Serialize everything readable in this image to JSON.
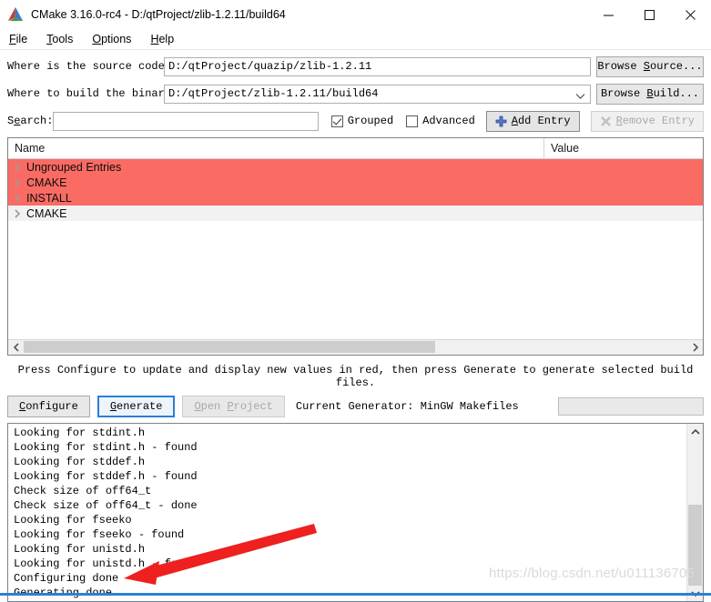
{
  "window": {
    "title": "CMake 3.16.0-rc4 - D:/qtProject/zlib-1.2.11/build64",
    "icon": "cmake-logo-icon",
    "controls": {
      "minimize": "minimize-icon",
      "maximize": "maximize-icon",
      "close": "close-icon"
    }
  },
  "menu": {
    "items": [
      {
        "label": "File",
        "mnemonic": "F"
      },
      {
        "label": "Tools",
        "mnemonic": "T"
      },
      {
        "label": "Options",
        "mnemonic": "O"
      },
      {
        "label": "Help",
        "mnemonic": "H"
      }
    ]
  },
  "form": {
    "source_label": "Where is the source code:",
    "source_value": "D:/qtProject/quazip/zlib-1.2.11",
    "browse_source_label": "Browse Source...",
    "build_label": "Where to build the binaries:",
    "build_value": "D:/qtProject/zlib-1.2.11/build64",
    "browse_build_label": "Browse Build...",
    "search_label": "Search:",
    "search_value": "",
    "search_placeholder": "",
    "grouped_label": "Grouped",
    "grouped_checked": true,
    "advanced_label": "Advanced",
    "advanced_checked": false,
    "add_entry_label": "Add Entry",
    "remove_entry_label": "Remove Entry",
    "remove_entry_enabled": false
  },
  "cache_table": {
    "columns": [
      "Name",
      "Value"
    ],
    "rows": [
      {
        "name": "Ungrouped Entries",
        "value": "",
        "state": "modified"
      },
      {
        "name": "CMAKE",
        "value": "",
        "state": "modified"
      },
      {
        "name": "INSTALL",
        "value": "",
        "state": "modified"
      },
      {
        "name": "CMAKE",
        "value": "",
        "state": "normal"
      }
    ],
    "row_colors": {
      "modified": "#fa6b64",
      "normal": "#f2f2f2"
    }
  },
  "status": {
    "hint": "Press Configure to update and display new values in red, then press Generate to generate selected build files."
  },
  "actions": {
    "configure_label": "Configure",
    "generate_label": "Generate",
    "open_project_label": "Open Project",
    "open_project_enabled": false,
    "current_generator": "Current Generator: MinGW Makefiles",
    "progress_value": ""
  },
  "log": {
    "lines": [
      "Looking for stdint.h",
      "Looking for stdint.h - found",
      "Looking for stddef.h",
      "Looking for stddef.h - found",
      "Check size of off64_t",
      "Check size of off64_t - done",
      "Looking for fseeko",
      "Looking for fseeko - found",
      "Looking for unistd.h",
      "Looking for unistd.h - found",
      "Configuring done",
      "Generating done"
    ]
  },
  "annotation": {
    "arrow_color": "#ee2020",
    "points_at": "Generating done"
  },
  "watermark": {
    "text": "https://blog.csdn.net/u011136705"
  }
}
